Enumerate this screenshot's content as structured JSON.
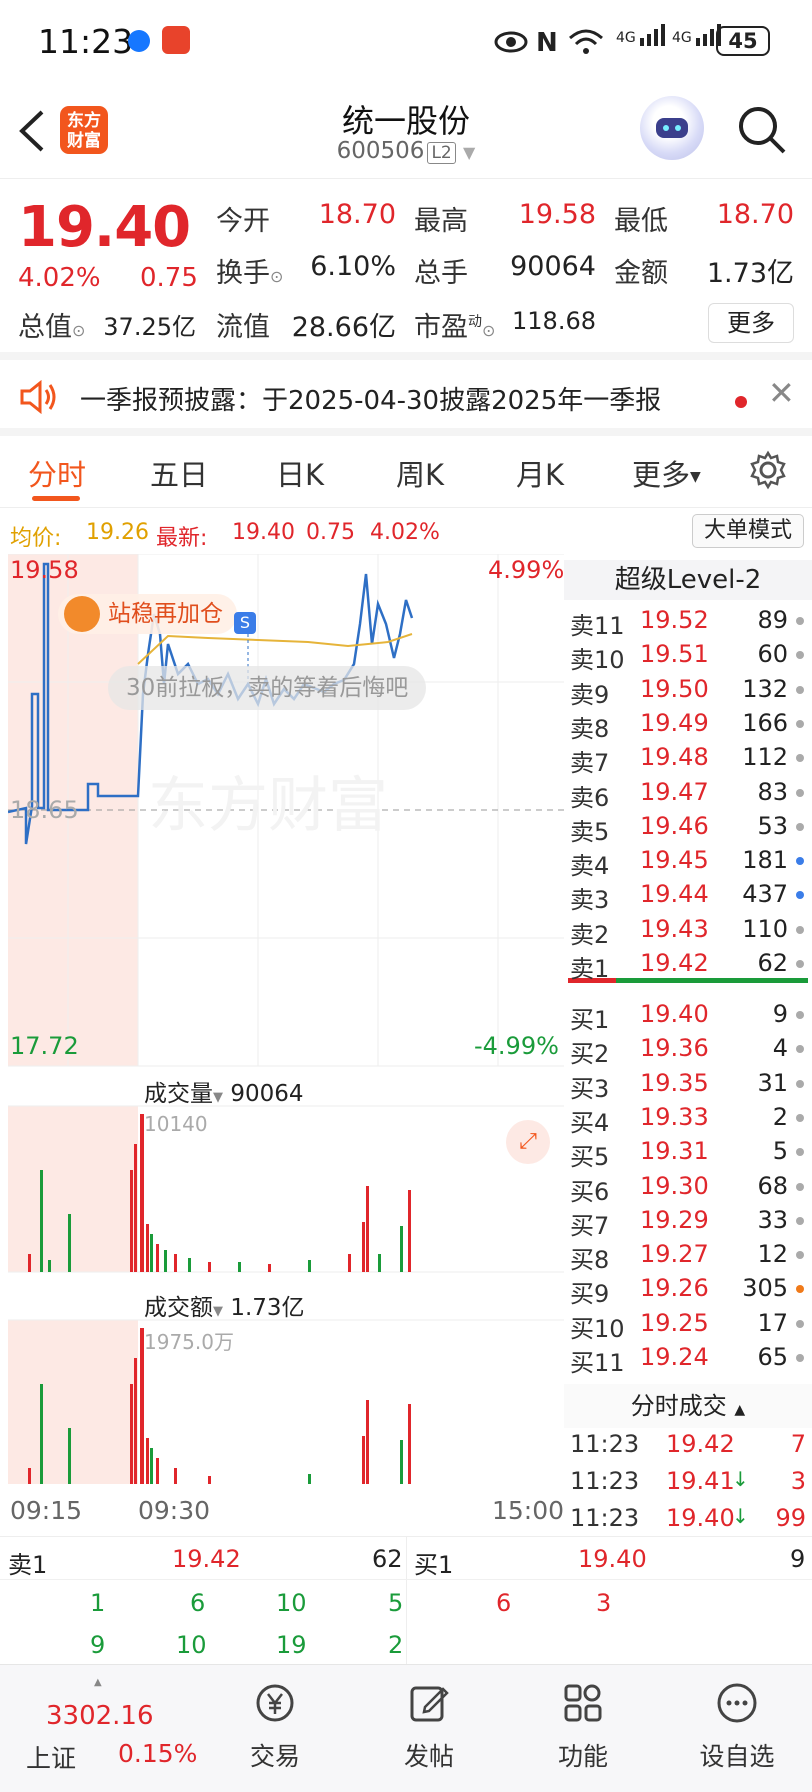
{
  "status_bar": {
    "time": "11:23",
    "battery": "45",
    "net1": "4G",
    "net2": "4G"
  },
  "header": {
    "logo_line1": "东方",
    "logo_line2": "财富",
    "title": "统一股份",
    "code": "600506",
    "level_badge": "L2"
  },
  "quote": {
    "price": "19.40",
    "change_pct": "4.02%",
    "change": "0.75",
    "open_label": "今开",
    "open": "18.70",
    "high_label": "最高",
    "high": "19.58",
    "low_label": "最低",
    "low": "18.70",
    "turnover_label": "换手",
    "turnover": "6.10%",
    "volume_label": "总手",
    "volume": "90064",
    "amount_label": "金额",
    "amount": "1.73亿",
    "mcap_label": "总值",
    "mcap": "37.25亿",
    "float_label": "流值",
    "float": "28.66亿",
    "pe_label": "市盈",
    "pe_sup": "动",
    "pe": "118.68",
    "more_label": "更多"
  },
  "notice": {
    "text": "一季报预披露：于2025-04-30披露2025年一季报"
  },
  "tabs": [
    "分时",
    "五日",
    "日K",
    "周K",
    "月K",
    "更多"
  ],
  "avg_bar": {
    "avg_label": "均价:",
    "avg": "19.26",
    "latest_label": "最新:",
    "latest": "19.40",
    "change": "0.75",
    "pct": "4.02%",
    "big_order_mode": "大单模式"
  },
  "chart": {
    "y_top": "19.58",
    "y_bottom": "17.72",
    "y_mid": "18.65",
    "pct_top": "4.99%",
    "pct_bottom": "-4.99%",
    "promo_text": "站稳再加仓",
    "promo_marker": "S",
    "comment_text": "30前拉板，卖的等着后悔吧",
    "watermark": "东方财富",
    "vol_label": "成交量",
    "vol_value": "90064",
    "vol_max": "10140",
    "amt_label": "成交额",
    "amt_value": "1.73亿",
    "amt_max": "1975.0万",
    "time_start": "09:15",
    "time_mid": "09:30",
    "time_end": "15:00"
  },
  "order_book": {
    "title": "超级Level-2",
    "asks": [
      {
        "label": "卖11",
        "price": "19.52",
        "vol": "89"
      },
      {
        "label": "卖10",
        "price": "19.51",
        "vol": "60"
      },
      {
        "label": "卖9",
        "price": "19.50",
        "vol": "132"
      },
      {
        "label": "卖8",
        "price": "19.49",
        "vol": "166"
      },
      {
        "label": "卖7",
        "price": "19.48",
        "vol": "112"
      },
      {
        "label": "卖6",
        "price": "19.47",
        "vol": "83"
      },
      {
        "label": "卖5",
        "price": "19.46",
        "vol": "53"
      },
      {
        "label": "卖4",
        "price": "19.45",
        "vol": "181"
      },
      {
        "label": "卖3",
        "price": "19.44",
        "vol": "437"
      },
      {
        "label": "卖2",
        "price": "19.43",
        "vol": "110"
      },
      {
        "label": "卖1",
        "price": "19.42",
        "vol": "62"
      }
    ],
    "bids": [
      {
        "label": "买1",
        "price": "19.40",
        "vol": "9"
      },
      {
        "label": "买2",
        "price": "19.36",
        "vol": "4"
      },
      {
        "label": "买3",
        "price": "19.35",
        "vol": "31"
      },
      {
        "label": "买4",
        "price": "19.33",
        "vol": "2"
      },
      {
        "label": "买5",
        "price": "19.31",
        "vol": "5"
      },
      {
        "label": "买6",
        "price": "19.30",
        "vol": "68"
      },
      {
        "label": "买7",
        "price": "19.29",
        "vol": "33"
      },
      {
        "label": "买8",
        "price": "19.27",
        "vol": "12"
      },
      {
        "label": "买9",
        "price": "19.26",
        "vol": "305"
      },
      {
        "label": "买10",
        "price": "19.25",
        "vol": "17"
      },
      {
        "label": "买11",
        "price": "19.24",
        "vol": "65"
      }
    ],
    "ticks_title": "分时成交",
    "ticks": [
      {
        "time": "11:23",
        "price": "19.42",
        "arrow": "",
        "vol": "7"
      },
      {
        "time": "11:23",
        "price": "19.41",
        "arrow": "↓",
        "vol": "3"
      },
      {
        "time": "11:23",
        "price": "19.40",
        "arrow": "↓",
        "vol": "99"
      }
    ]
  },
  "summary": {
    "ask_label": "卖1",
    "ask_price": "19.42",
    "ask_vol": "62",
    "bid_label": "买1",
    "bid_price": "19.40",
    "bid_vol": "9",
    "ask_row1": [
      "1",
      "6",
      "10",
      "5"
    ],
    "ask_row2": [
      "9",
      "10",
      "19",
      "2"
    ],
    "bid_row1": [
      "6",
      "3"
    ]
  },
  "bottom_nav": {
    "index_value": "3302.16",
    "index_name": "上证",
    "index_pct": "0.15%",
    "items": [
      "交易",
      "发帖",
      "功能",
      "设自选"
    ]
  }
}
